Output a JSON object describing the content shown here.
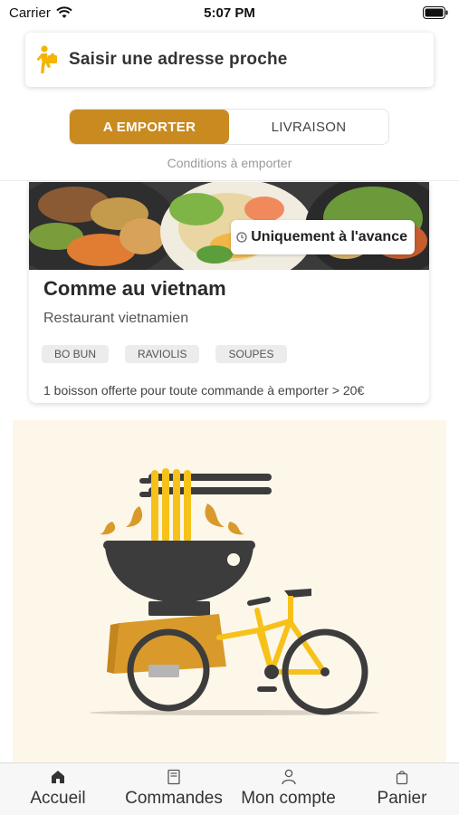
{
  "status_bar": {
    "carrier": "Carrier",
    "time": "5:07 PM"
  },
  "address": {
    "placeholder": "Saisir une adresse proche",
    "icon": "walking-person-icon"
  },
  "mode_toggle": {
    "options": [
      "A EMPORTER",
      "LIVRAISON"
    ],
    "selected": "A EMPORTER",
    "conditions_link": "Conditions à emporter"
  },
  "restaurant": {
    "badge": "Uniquement à l'avance",
    "name": "Comme au vietnam",
    "type": "Restaurant vietnamien",
    "tags": [
      "BO BUN",
      "RAVIOLIS",
      "SOUPES"
    ],
    "promo": "1 boisson offerte pour toute commande à emporter > 20€"
  },
  "illustration": {
    "subject": "noodle-bowl-on-cargo-bike-illustration"
  },
  "tab_bar": {
    "tabs": [
      {
        "label": "Accueil",
        "icon": "home-icon"
      },
      {
        "label": "Commandes",
        "icon": "receipt-icon"
      },
      {
        "label": "Mon compte",
        "icon": "person-icon"
      },
      {
        "label": "Panier",
        "icon": "bag-icon"
      }
    ],
    "active": "Accueil"
  },
  "colors": {
    "accent": "#c98a1f",
    "illustration_bg": "#fdf7ea",
    "bike_yellow": "#f6c21a",
    "dark": "#3c3c3c"
  }
}
